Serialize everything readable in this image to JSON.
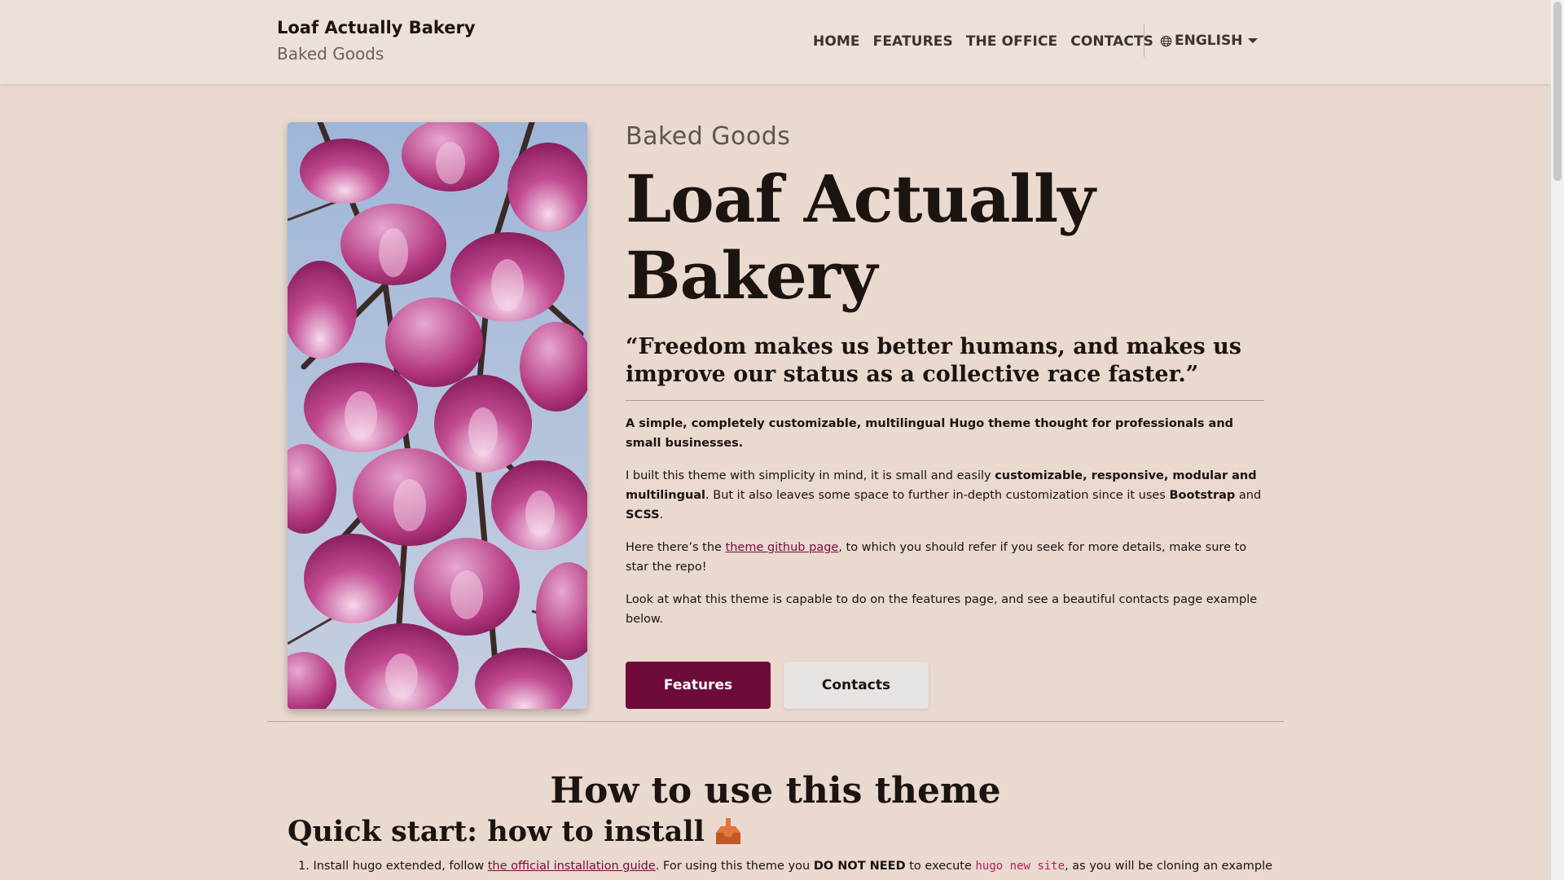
{
  "brand": {
    "title": "Loaf Actually Bakery",
    "subtitle": "Baked Goods"
  },
  "nav": {
    "items": [
      "HOME",
      "FEATURES",
      "THE OFFICE",
      "CONTACTS"
    ],
    "language": "ENGLISH"
  },
  "hero": {
    "eyebrow": "Baked Goods",
    "title": "Loaf Actually Bakery",
    "quote": "“Freedom makes us better humans, and makes us improve our status as a collective race faster.”",
    "p1": "A simple, completely customizable, multilingual Hugo theme thought for professionals and small businesses.",
    "p2": {
      "t1": "I built this theme with simplicity in mind, it is small and easily ",
      "b1": "customizable, responsive, modular and multilingual",
      "t2": ". But it also leaves some space to further in-depth customization since it uses ",
      "b2": "Bootstrap",
      "t3": " and ",
      "b3": "SCSS",
      "t4": "."
    },
    "p3": {
      "t1": "Here there’s the ",
      "link": "theme github page",
      "t2": ", to which you should refer if you seek for more details, make sure to star the repo!"
    },
    "p4": "Look at what this theme is capable to do on the features page, and see a beautiful contacts page example below.",
    "buttons": {
      "primary": "Features",
      "secondary": "Contacts"
    }
  },
  "section": {
    "title": "How to use this theme",
    "quickstart": "Quick start: how to install",
    "step1": {
      "num": "1.",
      "t1": "Install hugo extended, follow ",
      "link": "the official installation guide",
      "t2": ". For using this theme you ",
      "b1": "DO NOT NEED",
      "t3": " to execute ",
      "code": "hugo new site",
      "t4": ", as you will be cloning an example"
    }
  },
  "colors": {
    "accent": "#6e0b3a",
    "link": "#7a0c3f",
    "background": "#e9d9cf"
  }
}
